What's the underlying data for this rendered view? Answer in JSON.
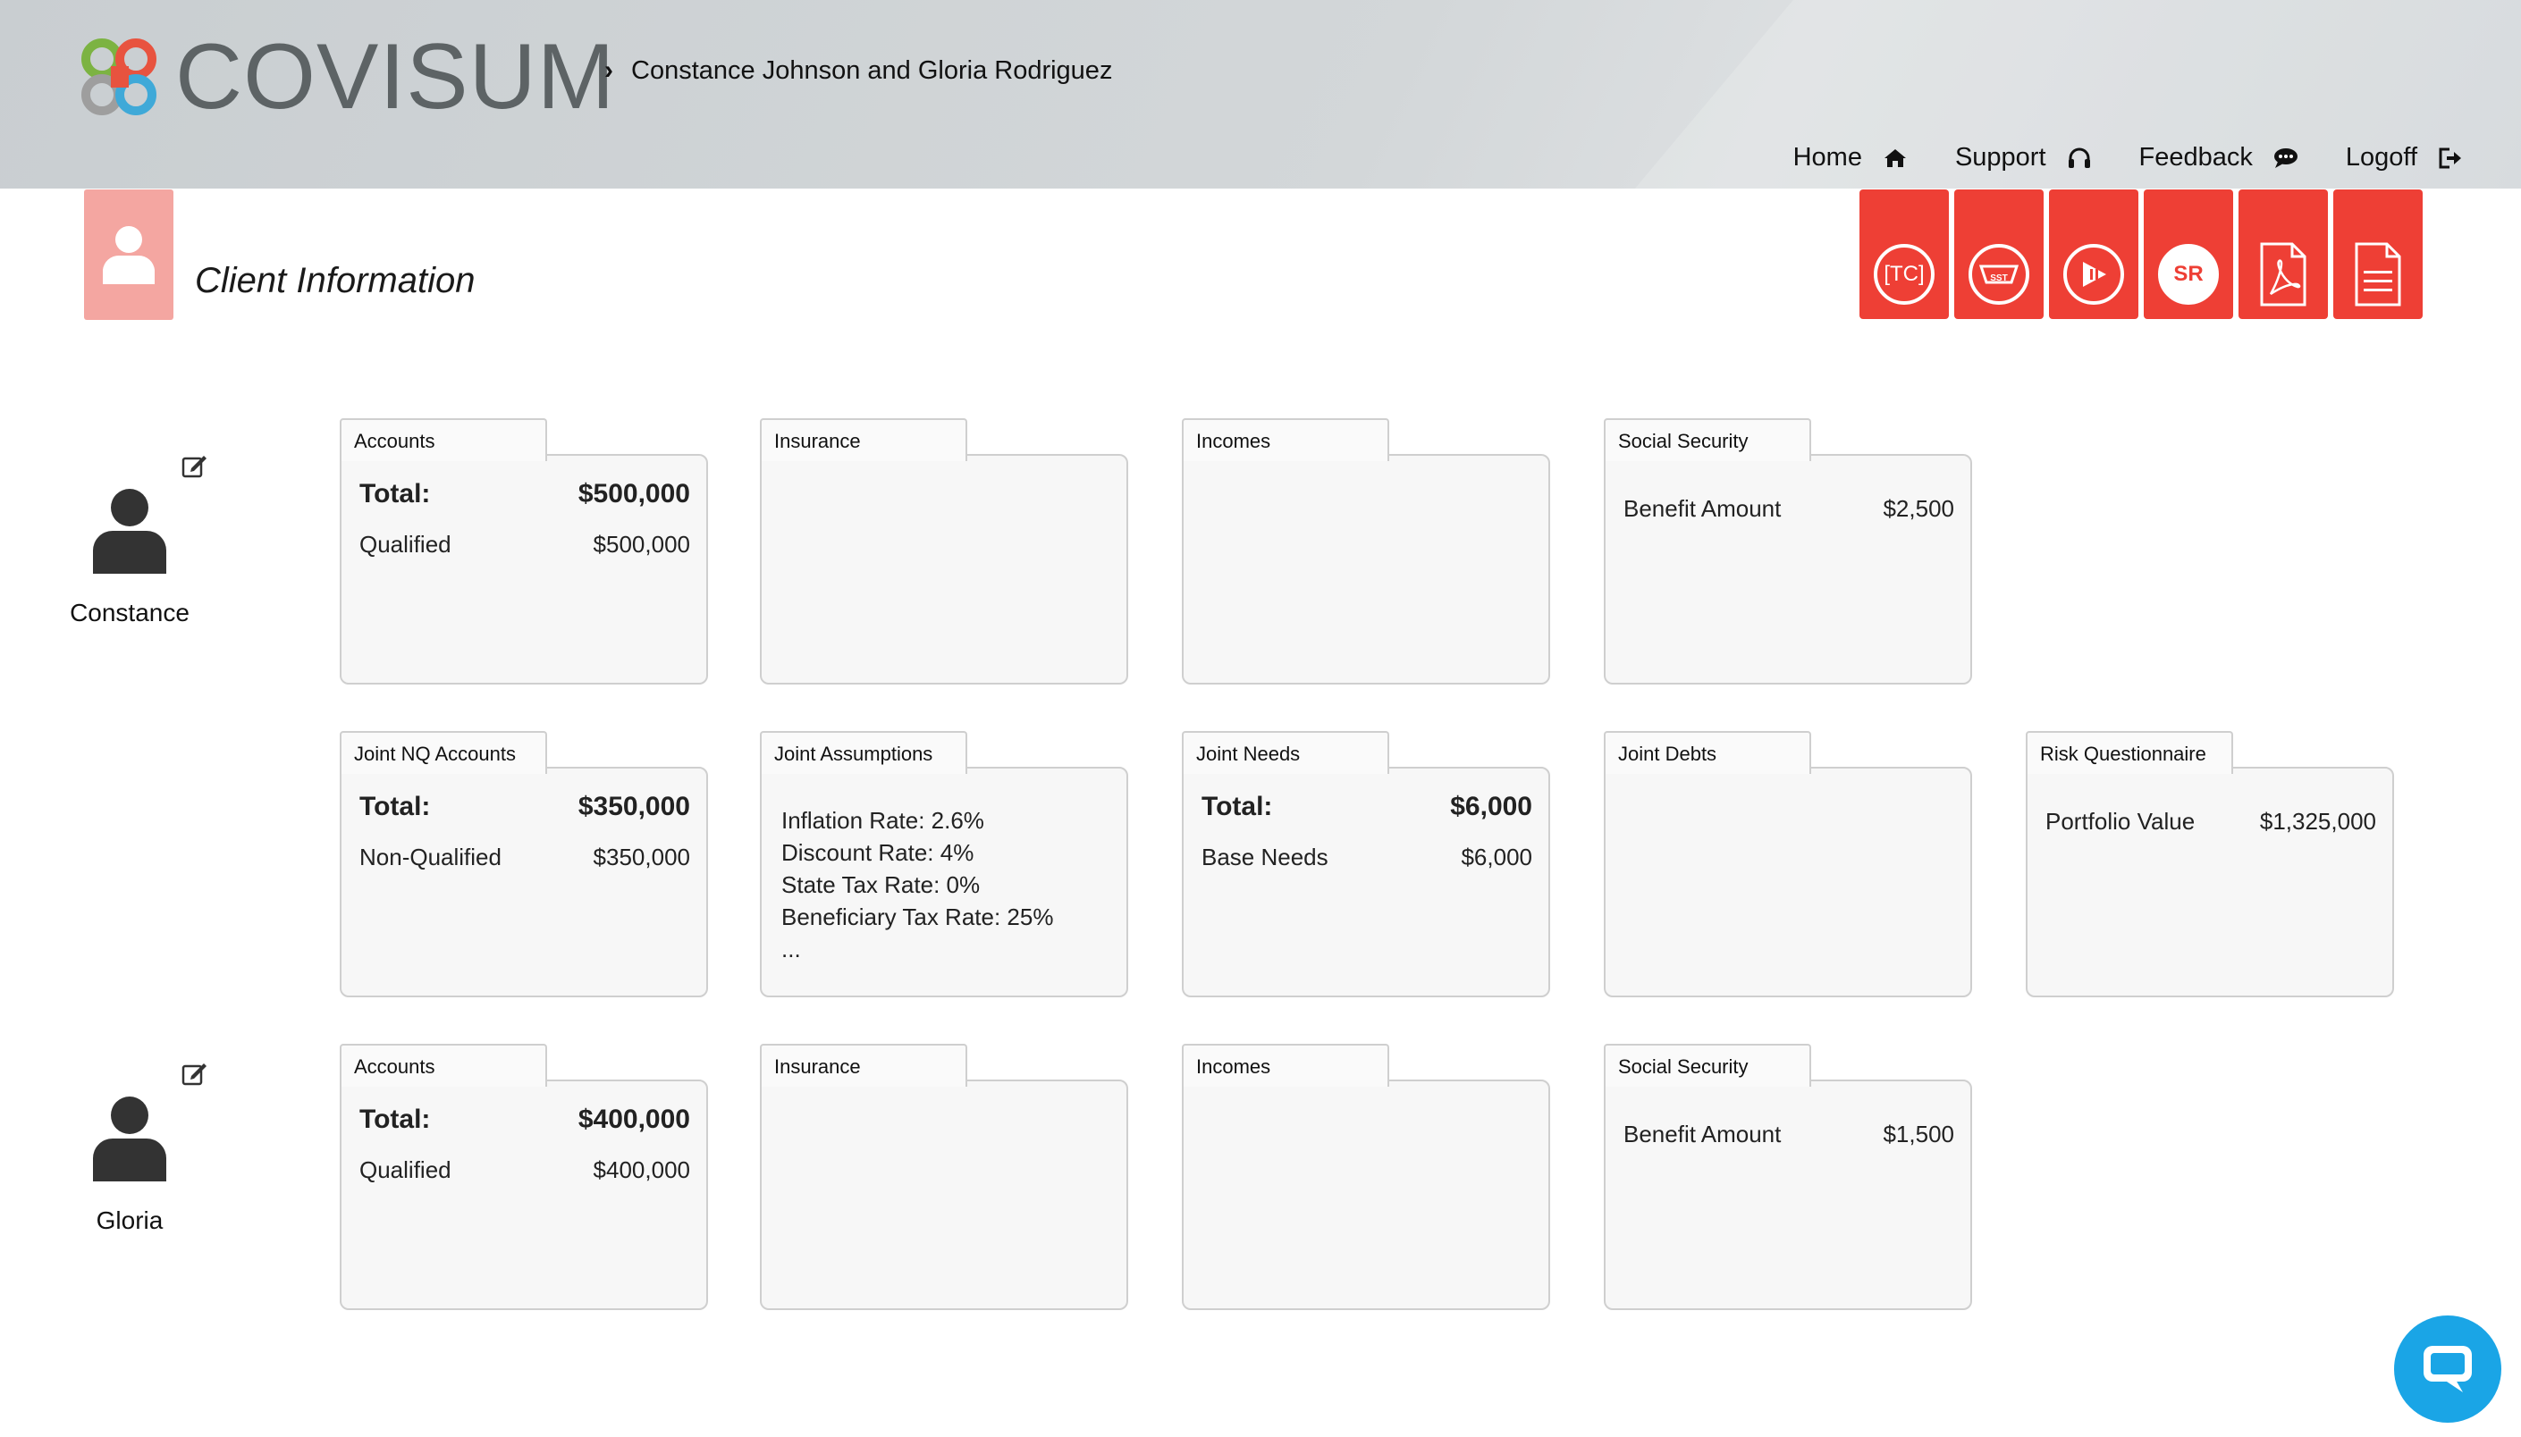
{
  "header": {
    "logo_text": "COVISUM",
    "breadcrumb": "Constance Johnson and Gloria Rodriguez",
    "nav": {
      "home": "Home",
      "support": "Support",
      "feedback": "Feedback",
      "logoff": "Logoff"
    }
  },
  "page": {
    "title": "Client Information",
    "tools": [
      "TC",
      "SST",
      "play-pause",
      "SR",
      "pdf",
      "document"
    ]
  },
  "persons": {
    "constance": {
      "name": "Constance"
    },
    "gloria": {
      "name": "Gloria"
    }
  },
  "constance_cards": {
    "accounts": {
      "tab": "Accounts",
      "total_label": "Total:",
      "total_value": "$500,000",
      "line_label": "Qualified",
      "line_value": "$500,000"
    },
    "insurance": {
      "tab": "Insurance"
    },
    "incomes": {
      "tab": "Incomes"
    },
    "social_security": {
      "tab": "Social Security",
      "line_label": "Benefit Amount",
      "line_value": "$2,500"
    }
  },
  "joint_cards": {
    "nq_accounts": {
      "tab": "Joint NQ Accounts",
      "total_label": "Total:",
      "total_value": "$350,000",
      "line_label": "Non-Qualified",
      "line_value": "$350,000"
    },
    "assumptions": {
      "tab": "Joint Assumptions",
      "lines": [
        "Inflation Rate: 2.6%",
        "Discount Rate: 4%",
        "State Tax Rate: 0%",
        "Beneficiary Tax Rate: 25%",
        "..."
      ]
    },
    "needs": {
      "tab": "Joint Needs",
      "total_label": "Total:",
      "total_value": "$6,000",
      "line_label": "Base Needs",
      "line_value": "$6,000"
    },
    "debts": {
      "tab": "Joint Debts"
    },
    "risk": {
      "tab": "Risk Questionnaire",
      "line_label": "Portfolio Value",
      "line_value": "$1,325,000"
    }
  },
  "gloria_cards": {
    "accounts": {
      "tab": "Accounts",
      "total_label": "Total:",
      "total_value": "$400,000",
      "line_label": "Qualified",
      "line_value": "$400,000"
    },
    "insurance": {
      "tab": "Insurance"
    },
    "incomes": {
      "tab": "Incomes"
    },
    "social_security": {
      "tab": "Social Security",
      "line_label": "Benefit Amount",
      "line_value": "$1,500"
    }
  },
  "colors": {
    "accent_red": "#ee3f35",
    "title_icon_bg": "#f4a6a1",
    "chat_blue": "#1aa5e6"
  }
}
